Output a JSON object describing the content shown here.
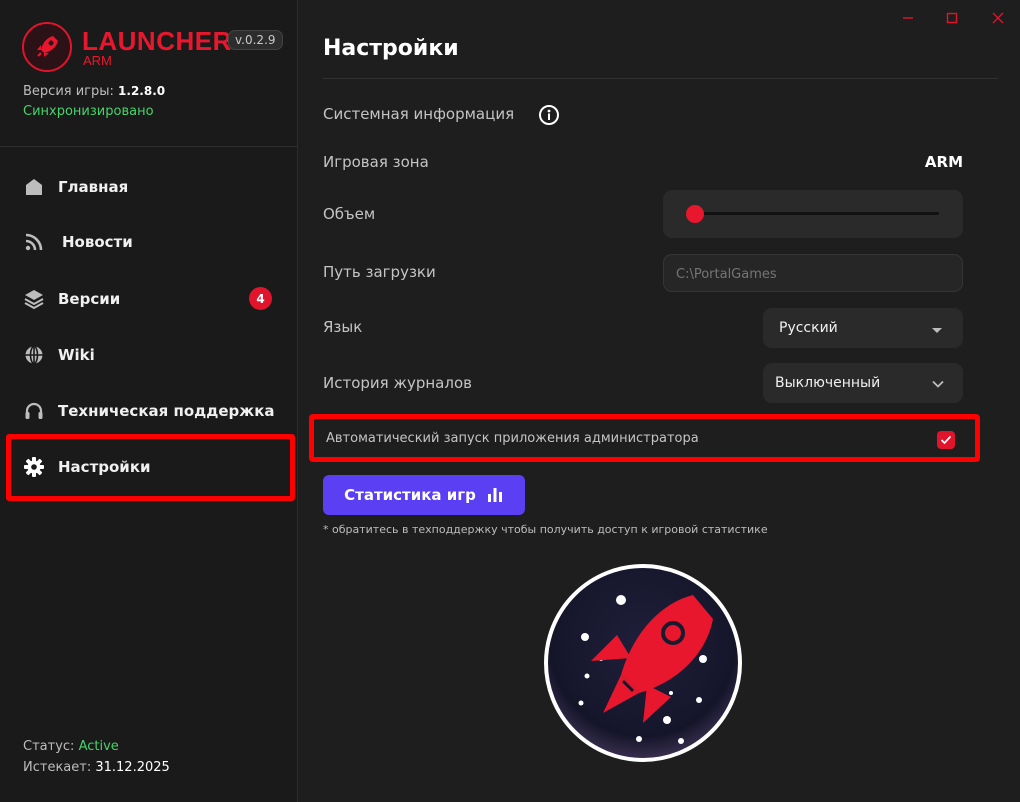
{
  "brand": {
    "name": "LAUNCHER",
    "sub": "ARM",
    "version": "v.0.2.9",
    "accent": "#e8172e"
  },
  "game": {
    "version_label": "Версия игры:",
    "version_value": "1.2.8.0",
    "sync_status": "Синхронизировано"
  },
  "nav": {
    "items": [
      {
        "label": "Главная",
        "icon": "home-icon"
      },
      {
        "label": "Новости",
        "icon": "rss-icon"
      },
      {
        "label": "Версии",
        "icon": "layers-icon",
        "badge": "4"
      },
      {
        "label": "Wiki",
        "icon": "globe-icon"
      },
      {
        "label": "Техническая поддержка",
        "icon": "headset-icon"
      },
      {
        "label": "Настройки",
        "icon": "gear-icon",
        "active": true
      }
    ]
  },
  "account": {
    "status_label": "Статус:",
    "status_value": "Active",
    "expires_label": "Истекает:",
    "expires_value": "31.12.2025"
  },
  "settings": {
    "title": "Настройки",
    "system_info_label": "Системная информация",
    "game_zone_label": "Игровая зона",
    "game_zone_value": "ARM",
    "volume_label": "Объем",
    "volume_value": 0.03,
    "download_path_label": "Путь загрузки",
    "download_path_placeholder": "C:\\PortalGames",
    "language_label": "Язык",
    "language_value": "Русский",
    "log_history_label": "История журналов",
    "log_history_value": "Выключенный",
    "auto_launch_label": "Автоматический запуск приложения администратора",
    "auto_launch_checked": true,
    "stats_button_label": "Статистика игр",
    "stats_footnote": "* обратитесь в техподдержку чтобы получить доступ к игровой статистике"
  },
  "colors": {
    "accent_red": "#e0142b",
    "success_green": "#47d36a",
    "button_purple": "#5b3ff2",
    "highlight_red": "#ff0000"
  }
}
